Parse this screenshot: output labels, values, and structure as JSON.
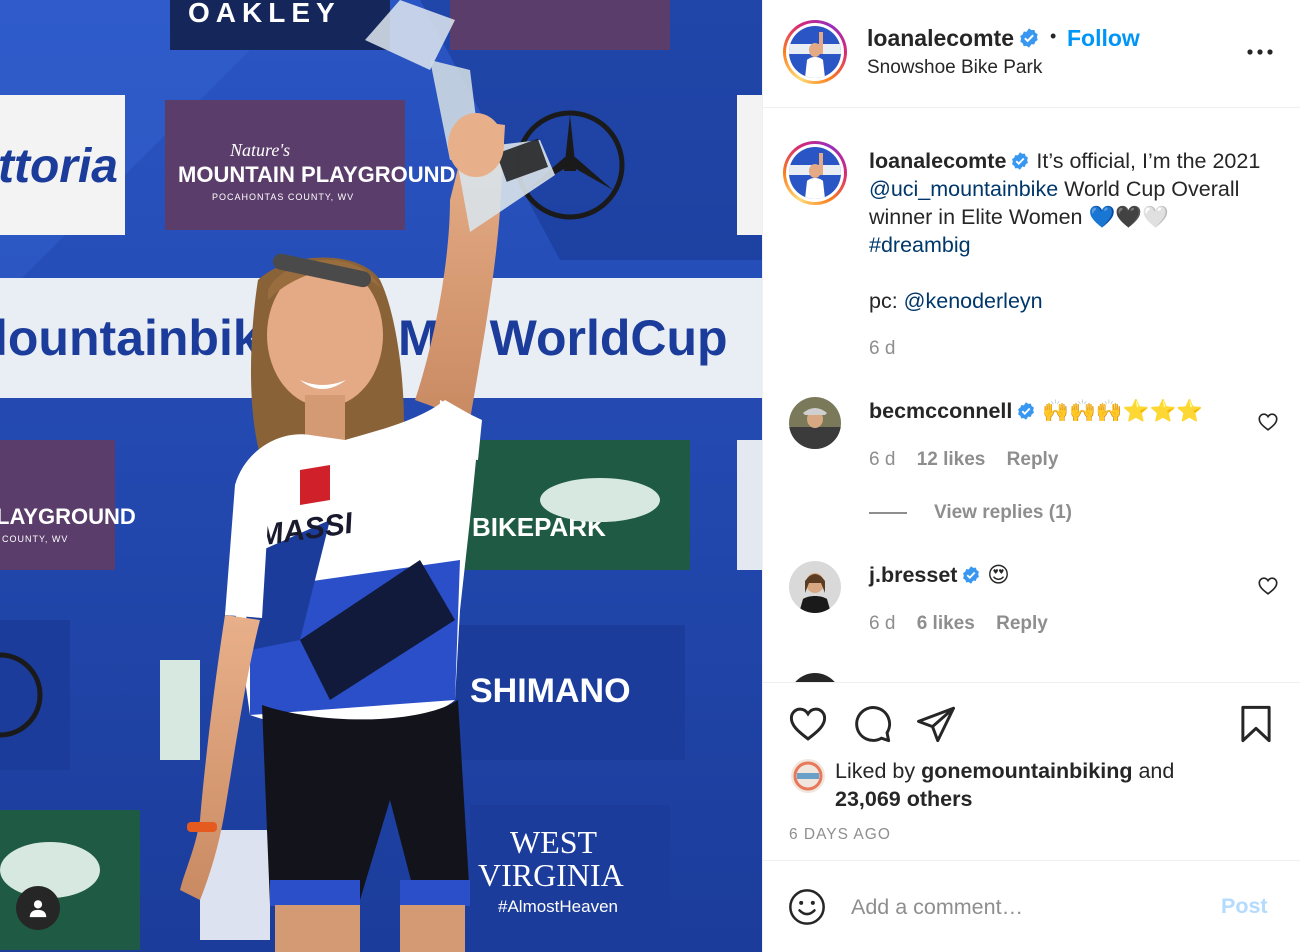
{
  "post": {
    "username": "loanalecomte",
    "follow_label": "Follow",
    "separator": "•",
    "location": "Snowshoe Bike Park",
    "caption": {
      "text_before": "It’s official, I’m the 2021 ",
      "mention": "@uci_mountainbike",
      "text_after": " World Cup Overall winner in Elite Women ",
      "emoji": "💙🖤🤍",
      "hashtag": "#dreambig",
      "pc_prefix": "pc: ",
      "pc_mention": "@kenoderleyn",
      "time": "6 d"
    },
    "comments": [
      {
        "username": "becmcconnell",
        "text": "🙌🙌🙌⭐⭐⭐",
        "time": "6 d",
        "likes": "12 likes",
        "reply": "Reply",
        "view_replies": "View replies (1)"
      },
      {
        "username": "j.bresset",
        "text": "😍",
        "time": "6 d",
        "likes": "6 likes",
        "reply": "Reply"
      }
    ],
    "liked_by": {
      "prefix": "Liked by ",
      "user": "gonemountainbiking",
      "middle": " and",
      "others": "23,069 others"
    },
    "date": "6 DAYS AGO",
    "comment_placeholder": "Add a comment…",
    "post_label": "Post"
  },
  "photo": {
    "banners": {
      "oakley": "OAKLEY",
      "natures": "Nature's",
      "mountain_playground": "MOUNTAIN PLAYGROUND",
      "pocahontas": "POCAHONTAS COUNTY, WV",
      "vittoria": "ttoria",
      "worldcup": "lountainbike",
      "worldcup2": "MB WorldCup",
      "playground_left": "LAYGROUND",
      "county_left": "COUNTY, WV",
      "snowshoe": "BIKEPARK",
      "shimano": "SHIMANO",
      "west": "WEST",
      "virginia": "VIRGINIA",
      "almost_heaven": "#AlmostHeaven",
      "massi": "MASSI"
    }
  },
  "colors": {
    "accent": "#0095f6",
    "link": "#00376b",
    "muted": "#8e8e8e",
    "verified": "#3897f0",
    "post_disabled": "#b3dbff"
  },
  "icons": [
    "verified-icon",
    "more-icon",
    "heart-icon",
    "comment-icon",
    "share-icon",
    "bookmark-icon",
    "emoji-icon",
    "person-icon"
  ]
}
